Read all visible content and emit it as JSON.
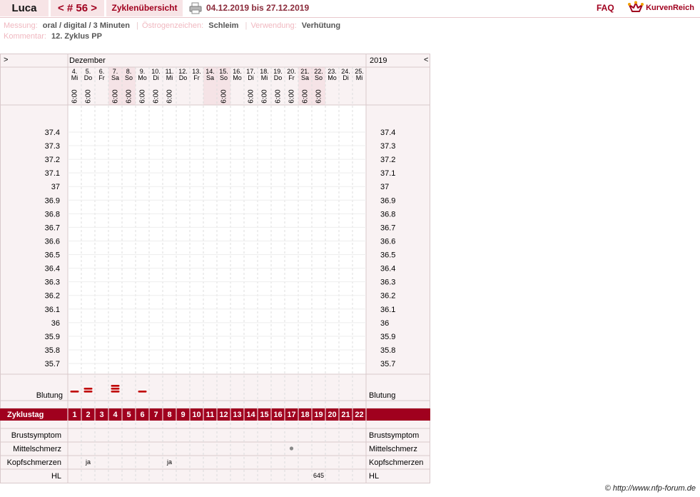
{
  "header": {
    "user_name": "Luca",
    "cycle_nav": "< # 56 >",
    "overview_label": "Zyklenübersicht",
    "printer_icon": "printer-icon",
    "date_range": "04.12.2019 bis 27.12.2019",
    "faq_label": "FAQ",
    "brand": "KurvenReich"
  },
  "meta": {
    "messung_label": "Messung:",
    "messung_value": "oral / digital / 3 Minuten",
    "oestrogen_label": "Östrogenzeichen:",
    "oestrogen_value": "Schleim",
    "verwendung_label": "Verwendung:",
    "verwendung_value": "Verhütung",
    "kommentar_label": "Kommentar:",
    "kommentar_value": "12. Zyklus PP"
  },
  "chart": {
    "nav_left": ">",
    "nav_right": "<",
    "month": "Dezember",
    "year": "2019",
    "days": [
      {
        "d": "4.",
        "w": "Mi",
        "t": "6:00",
        "hl": false
      },
      {
        "d": "5.",
        "w": "Do",
        "t": "6:00",
        "hl": false
      },
      {
        "d": "6.",
        "w": "Fr",
        "t": "",
        "hl": false
      },
      {
        "d": "7.",
        "w": "Sa",
        "t": "6:00",
        "hl": true
      },
      {
        "d": "8.",
        "w": "So",
        "t": "6:00",
        "hl": true
      },
      {
        "d": "9.",
        "w": "Mo",
        "t": "6:00",
        "hl": false
      },
      {
        "d": "10.",
        "w": "Di",
        "t": "6:00",
        "hl": false
      },
      {
        "d": "11.",
        "w": "Mi",
        "t": "6:00",
        "hl": false
      },
      {
        "d": "12.",
        "w": "Do",
        "t": "",
        "hl": false
      },
      {
        "d": "13.",
        "w": "Fr",
        "t": "",
        "hl": false
      },
      {
        "d": "14.",
        "w": "Sa",
        "t": "",
        "hl": true
      },
      {
        "d": "15.",
        "w": "So",
        "t": "6:00",
        "hl": true
      },
      {
        "d": "16.",
        "w": "Mo",
        "t": "",
        "hl": false
      },
      {
        "d": "17.",
        "w": "Di",
        "t": "6:00",
        "hl": false
      },
      {
        "d": "18.",
        "w": "Mi",
        "t": "6:00",
        "hl": false
      },
      {
        "d": "19.",
        "w": "Do",
        "t": "6:00",
        "hl": false
      },
      {
        "d": "20.",
        "w": "Fr",
        "t": "6:00",
        "hl": false
      },
      {
        "d": "21.",
        "w": "Sa",
        "t": "6:00",
        "hl": true
      },
      {
        "d": "22.",
        "w": "So",
        "t": "6:00",
        "hl": true
      },
      {
        "d": "23.",
        "w": "Mo",
        "t": "",
        "hl": false
      },
      {
        "d": "24.",
        "w": "Di",
        "t": "",
        "hl": false
      },
      {
        "d": "25.",
        "w": "Mi",
        "t": "",
        "hl": false
      }
    ],
    "temperatures": [
      "37.4",
      "37.3",
      "37.2",
      "37.1",
      "37",
      "36.9",
      "36.8",
      "36.7",
      "36.6",
      "36.5",
      "36.4",
      "36.3",
      "36.2",
      "36.1",
      "36",
      "35.9",
      "35.8",
      "35.7"
    ],
    "bleeding_label": "Blutung",
    "bleeding": [
      1,
      2,
      0,
      3,
      0,
      1,
      0,
      0,
      0,
      0,
      0,
      0,
      0,
      0,
      0,
      0,
      0,
      0,
      0,
      0,
      0,
      0
    ],
    "cycle_day_label": "Zyklustag",
    "cycle_days": [
      "1",
      "2",
      "3",
      "4",
      "5",
      "6",
      "7",
      "8",
      "9",
      "10",
      "11",
      "12",
      "13",
      "14",
      "15",
      "16",
      "17",
      "18",
      "19",
      "20",
      "21",
      "22"
    ],
    "rows": [
      {
        "label": "Brustsymptom",
        "cells": {}
      },
      {
        "label": "Mittelschmerz",
        "cells": {
          "16": "dot"
        }
      },
      {
        "label": "Kopfschmerzen",
        "cells": {
          "1": "ja",
          "7": "ja"
        }
      },
      {
        "label": "HL",
        "cells": {
          "18": "645"
        }
      }
    ],
    "colors": {
      "accent": "#a0001e",
      "tint": "#f9f2f3",
      "weekend": "#f5e3e6",
      "bleed": "#c00000",
      "grid": "#d9c9cb"
    }
  },
  "footer": {
    "credit": "© http://www.nfp-forum.de"
  }
}
